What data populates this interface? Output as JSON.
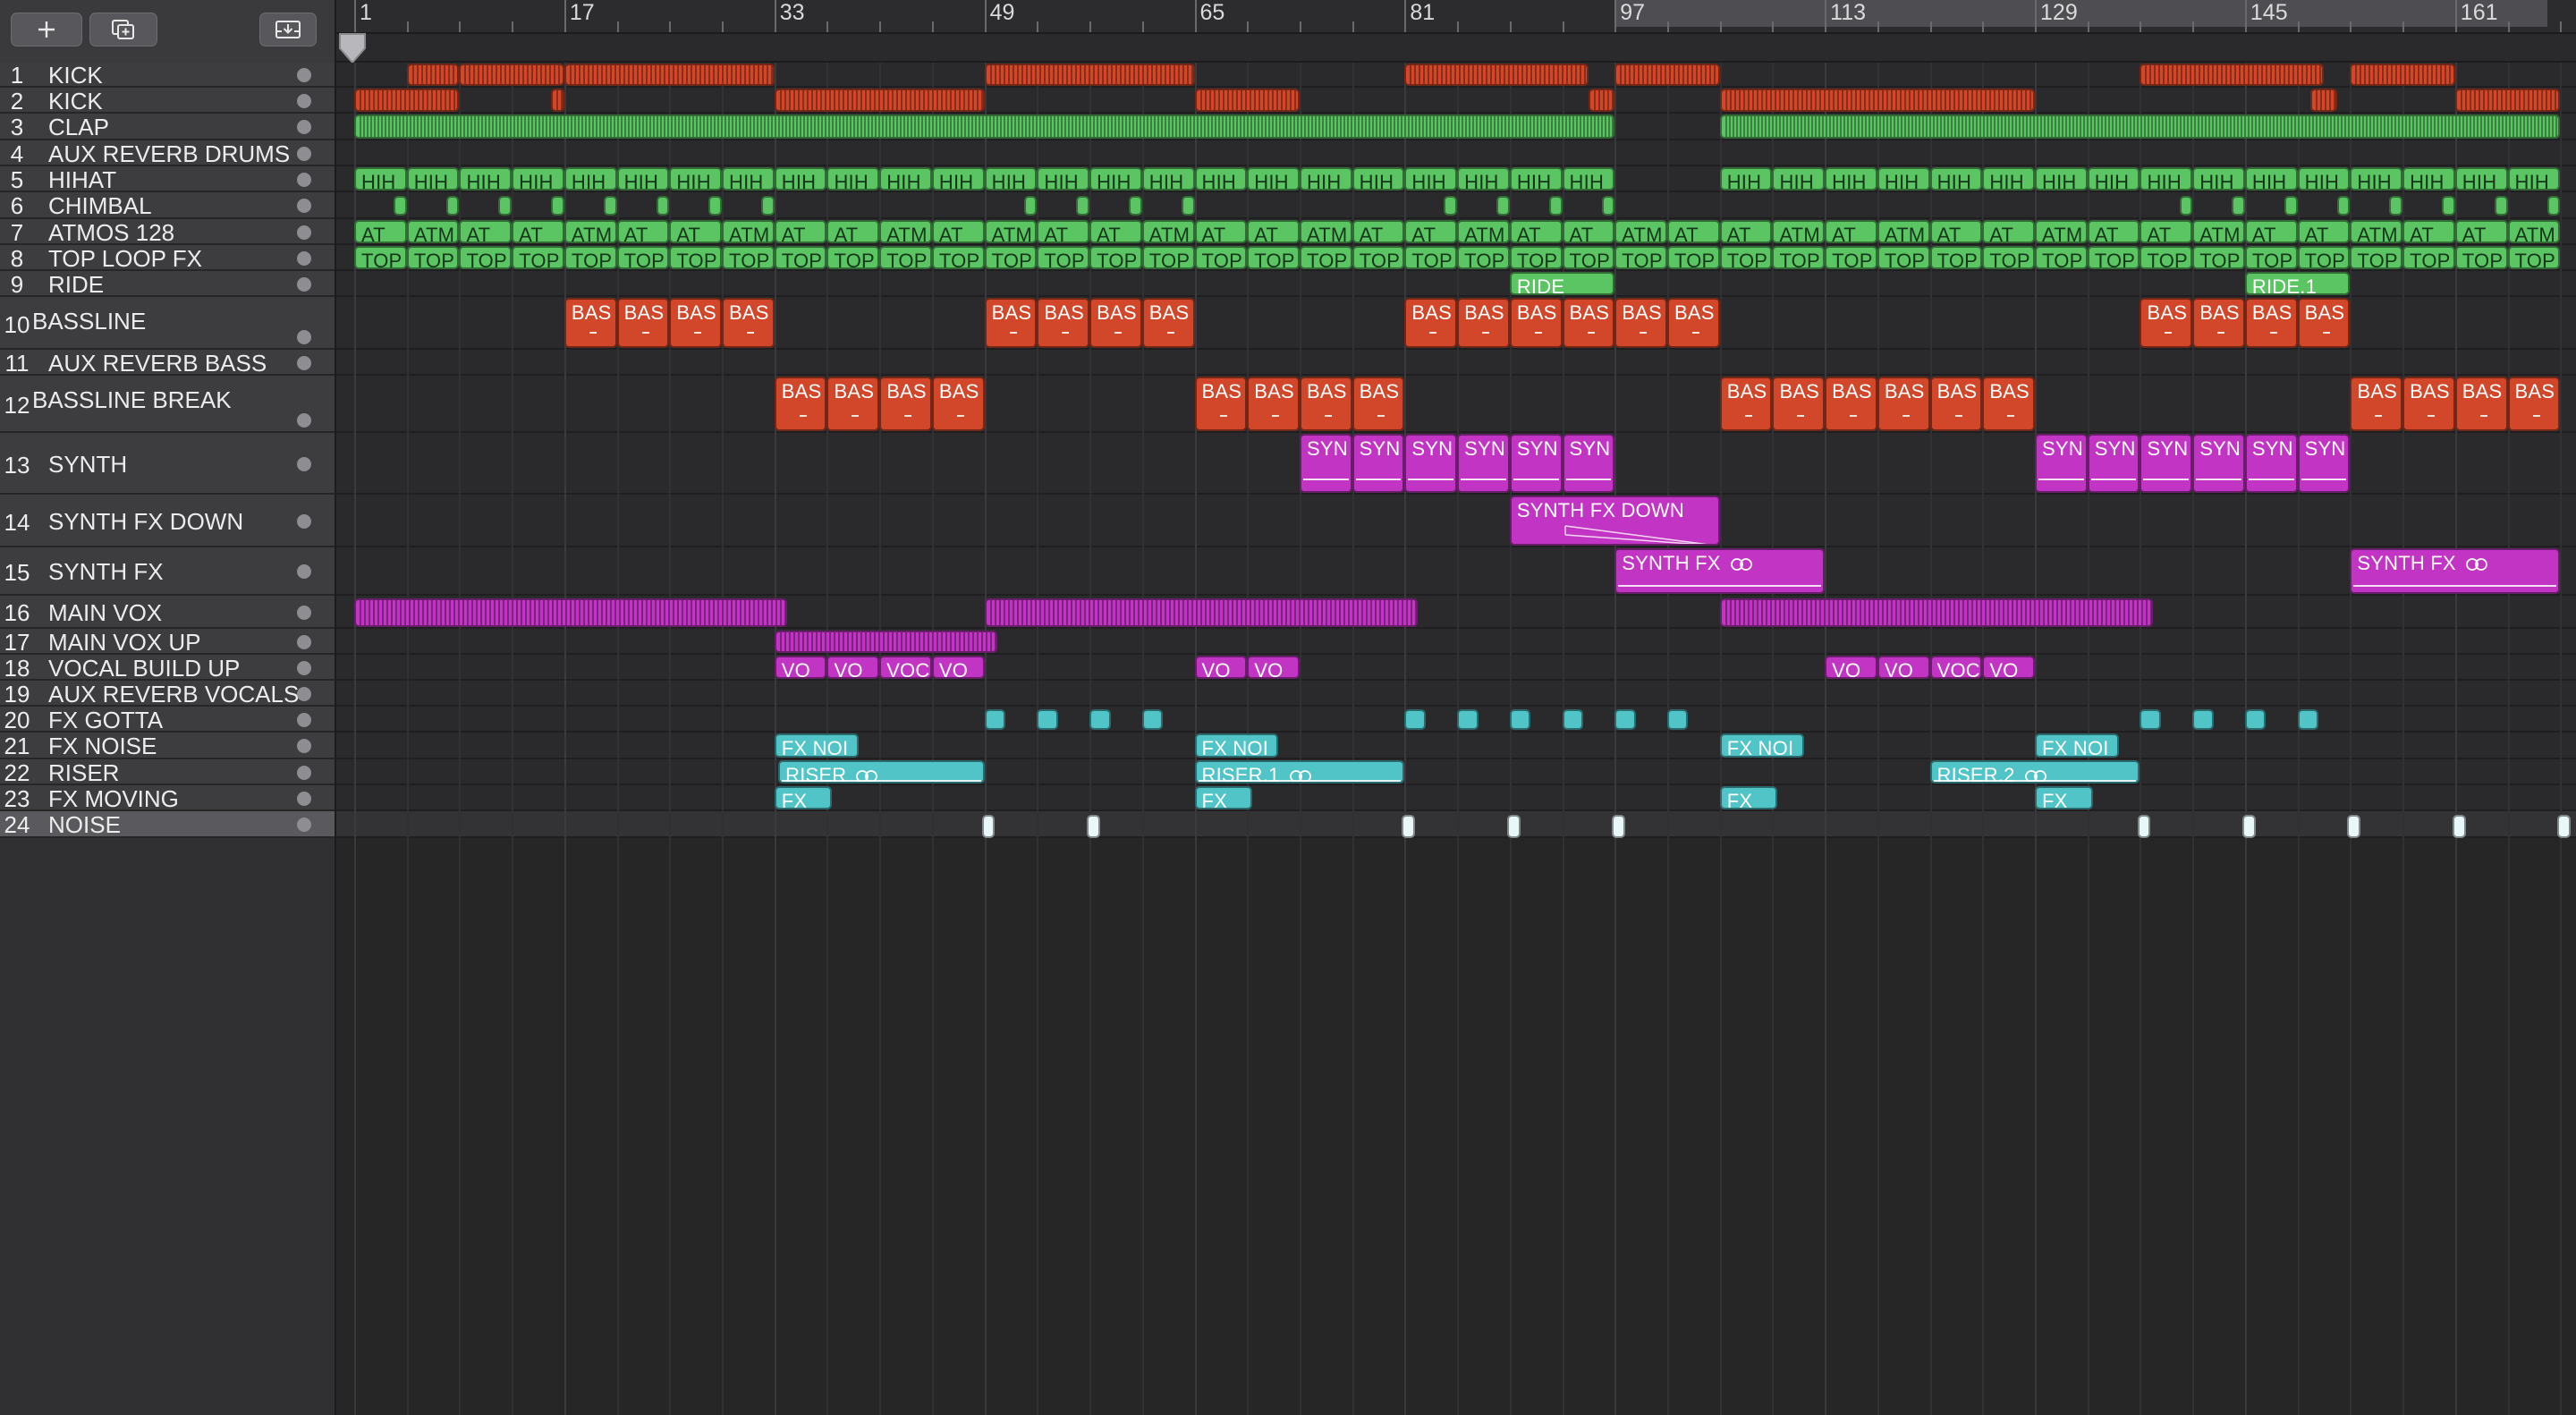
{
  "toolbar": {
    "buttons": [
      {
        "name": "add-track-button",
        "icon": "plus-icon"
      },
      {
        "name": "duplicate-track-button",
        "icon": "duplicate-icon"
      },
      {
        "name": "download-button",
        "icon": "download-tray-icon"
      }
    ]
  },
  "ruler": {
    "bars": [
      "1",
      "17",
      "33",
      "49",
      "65",
      "81",
      "97",
      "113",
      "129",
      "145",
      "161"
    ],
    "cycle": {
      "from_bar": 97,
      "to_bar": 168
    }
  },
  "colors": {
    "red": "#d2472a",
    "green": "#5ac562",
    "magenta": "#c235c4",
    "cyan": "#50c4c6",
    "header_bg": "#3d3d40",
    "header_selected": "#5a5a5e"
  },
  "tracks": [
    {
      "num": "1",
      "name": "KICK"
    },
    {
      "num": "2",
      "name": "KICK"
    },
    {
      "num": "3",
      "name": "CLAP"
    },
    {
      "num": "4",
      "name": "AUX REVERB DRUMS"
    },
    {
      "num": "5",
      "name": "HIHAT"
    },
    {
      "num": "6",
      "name": "CHIMBAL"
    },
    {
      "num": "7",
      "name": "ATMOS 128"
    },
    {
      "num": "8",
      "name": "TOP LOOP FX"
    },
    {
      "num": "9",
      "name": "RIDE"
    },
    {
      "num": "10",
      "name": "BASSLINE"
    },
    {
      "num": "11",
      "name": "AUX REVERB BASS"
    },
    {
      "num": "12",
      "name": "BASSLINE BREAK"
    },
    {
      "num": "13",
      "name": "SYNTH"
    },
    {
      "num": "14",
      "name": "SYNTH FX DOWN"
    },
    {
      "num": "15",
      "name": "SYNTH FX"
    },
    {
      "num": "16",
      "name": "MAIN VOX"
    },
    {
      "num": "17",
      "name": "MAIN VOX UP"
    },
    {
      "num": "18",
      "name": "VOCAL BUILD UP"
    },
    {
      "num": "19",
      "name": "AUX REVERB VOCALS"
    },
    {
      "num": "20",
      "name": "FX GOTTA"
    },
    {
      "num": "21",
      "name": "FX NOISE"
    },
    {
      "num": "22",
      "name": "RISER"
    },
    {
      "num": "23",
      "name": "FX MOVING"
    },
    {
      "num": "24",
      "name": "NOISE"
    }
  ],
  "labels": {
    "hihat": "HIH",
    "atmos": [
      "AT",
      "ATM",
      "AT",
      "AT",
      "ATM",
      "AT",
      "AT",
      "ATM",
      "AT",
      "AT",
      "ATM",
      "AT",
      "ATM",
      "AT",
      "AT",
      "ATM",
      "AT",
      "AT",
      "ATM",
      "AT",
      "AT",
      "ATM",
      "AT",
      "AT",
      "ATM",
      "AT",
      "AT",
      "ATM",
      "AT",
      "ATM",
      "AT",
      "AT",
      "ATM",
      "AT",
      "AT",
      "ATM",
      "AT",
      "AT",
      "ATM",
      "AT",
      "AT",
      "ATM"
    ],
    "top": "TOP",
    "ride": [
      "RIDE",
      "RIDE.1"
    ],
    "bass": "BAS",
    "synth": "SYN",
    "synth_fx_down": "SYNTH FX DOWN",
    "synth_fx": "SYNTH FX",
    "vocal_build": [
      "VO",
      "VO",
      "VOC",
      "VO",
      "VO",
      "VO",
      "VO",
      "VO",
      "VOC",
      "VO"
    ],
    "fx_noise": "FX NOI",
    "risers": [
      "RISER",
      "RISER.1",
      "RISER.2"
    ],
    "fx_moving": "FX"
  }
}
